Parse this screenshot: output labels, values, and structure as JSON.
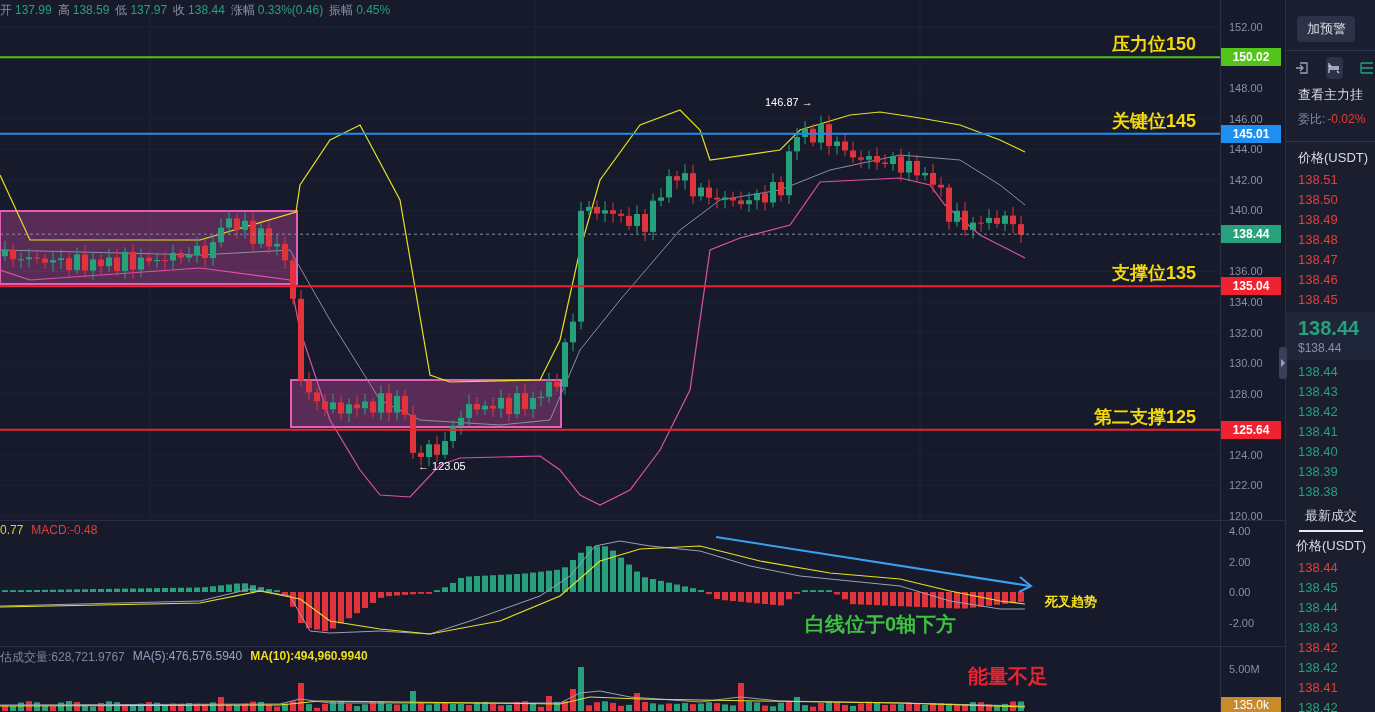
{
  "ohlc_bar": [
    {
      "label": "开",
      "value": "137.99"
    },
    {
      "label": "高",
      "value": "138.59"
    },
    {
      "label": "低",
      "value": "137.97"
    },
    {
      "label": "收",
      "value": "138.44"
    },
    {
      "label": "涨幅",
      "value": "0.33%(0.46)"
    },
    {
      "label": "振幅",
      "value": "0.45%"
    }
  ],
  "price_chart": {
    "ticks": [
      "152.00",
      "148.00",
      "146.00",
      "144.00",
      "142.00",
      "140.00",
      "136.00",
      "134.00",
      "132.00",
      "130.00",
      "128.00",
      "124.00",
      "122.00",
      "120.00"
    ],
    "levels": [
      {
        "kind": "line",
        "label": "压力位150",
        "tag": "150.02",
        "color": "#52c41a"
      },
      {
        "kind": "line",
        "label": "关键位145",
        "tag": "145.01",
        "color": "#1e8ff0"
      },
      {
        "kind": "current",
        "tag": "138.44",
        "color": "#26a17b"
      },
      {
        "kind": "line",
        "label": "支撑位135",
        "tag": "135.04",
        "color": "#f0222f"
      },
      {
        "kind": "line",
        "label": "第二支撑125",
        "tag": "125.64",
        "color": "#f0222f"
      }
    ],
    "high_marker": "146.87 →",
    "low_marker": "← 123.05"
  },
  "macd": {
    "header": [
      {
        "text": "0.77",
        "color": "#e8d21e"
      },
      {
        "text": "MACD:-0.48",
        "color": "#e0403c"
      }
    ],
    "ticks": [
      "4.00",
      "2.00",
      "0.00",
      "-2.00"
    ],
    "notes": [
      {
        "text": "白线位于0轴下方",
        "color": "#3cc43c"
      },
      {
        "text": "死叉趋势",
        "color": "#f5e020"
      }
    ]
  },
  "volume": {
    "header": [
      {
        "text": "估成交量:628,721.9767",
        "color": "#80869a"
      },
      {
        "text": "MA(5):476,576.5940",
        "color": "#9aa0c4"
      },
      {
        "text": "MA(10):494,960.9940",
        "color": "#f0dc1e"
      }
    ],
    "ticks": [
      "5.00M"
    ],
    "last_tag": "135.0k",
    "note": {
      "text": "能量不足",
      "color": "#f0222f"
    }
  },
  "right_panel": {
    "alert_button": "加预警",
    "tool_icons": [
      {
        "kind": "exit",
        "selected": false
      },
      {
        "kind": "swap",
        "selected": true
      },
      {
        "kind": "list",
        "selected": false
      }
    ],
    "main_orders_link": "查看主力挂",
    "ratio_label": "委比:",
    "ratio_value": "-0.02%",
    "book_header": "价格(USDT)",
    "asks": [
      "138.51",
      "138.50",
      "138.49",
      "138.48",
      "138.47",
      "138.46",
      "138.45"
    ],
    "last_price": "138.44",
    "last_price_usd": "$138.44",
    "bids": [
      "138.44",
      "138.43",
      "138.42",
      "138.41",
      "138.40",
      "138.39",
      "138.38"
    ],
    "trades_tab": {
      "label": "最新成交",
      "selected": true
    },
    "trades_header": "价格(USDT)",
    "trades": [
      {
        "price": "138.44",
        "color": "#e0403c"
      },
      {
        "price": "138.45",
        "color": "#26a17b"
      },
      {
        "price": "138.44",
        "color": "#26a17b"
      },
      {
        "price": "138.43",
        "color": "#26a17b"
      },
      {
        "price": "138.42",
        "color": "#e0403c"
      },
      {
        "price": "138.42",
        "color": "#26a17b"
      },
      {
        "price": "138.41",
        "color": "#e0403c"
      },
      {
        "price": "138.42",
        "color": "#26a17b"
      }
    ]
  }
}
